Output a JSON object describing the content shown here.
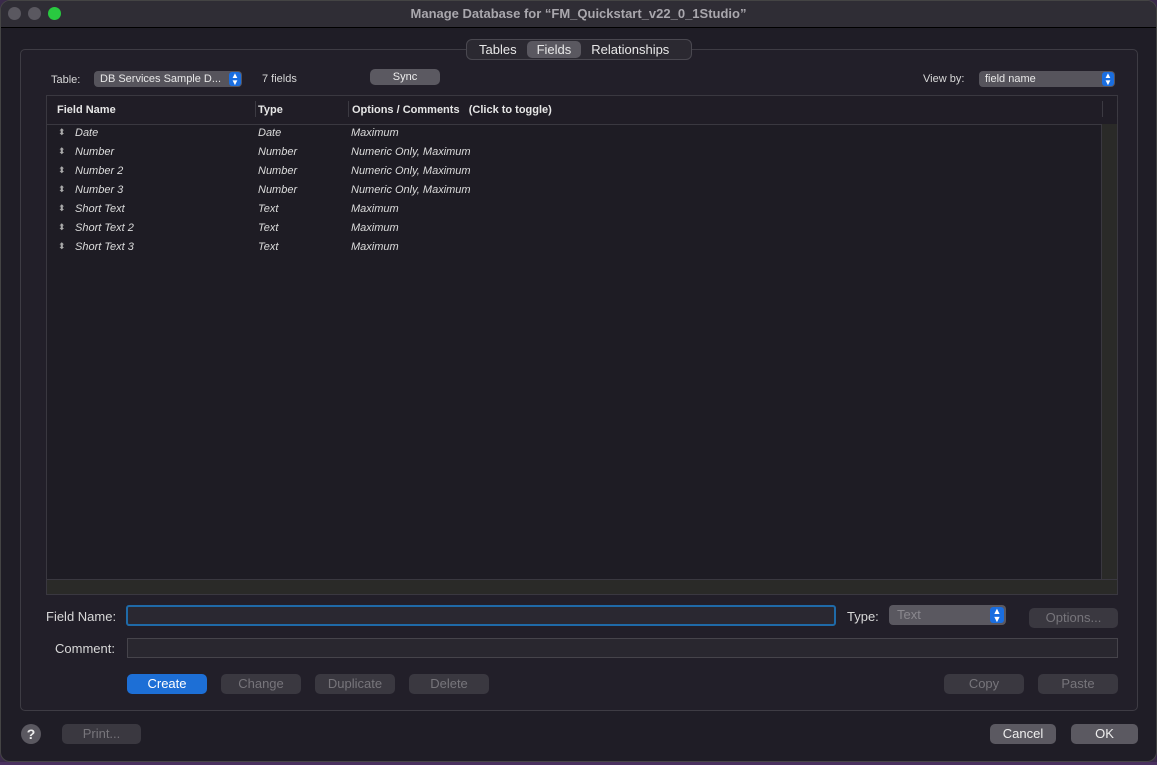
{
  "window": {
    "title": "Manage Database for “FM_Quickstart_v22_0_1Studio”"
  },
  "tabs": [
    {
      "label": "Tables",
      "active": false
    },
    {
      "label": "Fields",
      "active": true
    },
    {
      "label": "Relationships",
      "active": false
    }
  ],
  "toolbar": {
    "table_label": "Table:",
    "table_value": "DB Services Sample D...",
    "field_count": "7 fields",
    "sync_label": "Sync",
    "view_by_label": "View by:",
    "view_by_value": "field name"
  },
  "list": {
    "columns": [
      "Field Name",
      "Type",
      "Options / Comments   (Click to toggle)"
    ],
    "rows": [
      {
        "name": "Date",
        "type": "Date",
        "options": "Maximum"
      },
      {
        "name": "Number",
        "type": "Number",
        "options": "Numeric Only, Maximum"
      },
      {
        "name": "Number 2",
        "type": "Number",
        "options": "Numeric Only, Maximum"
      },
      {
        "name": "Number 3",
        "type": "Number",
        "options": "Numeric Only, Maximum"
      },
      {
        "name": "Short Text",
        "type": "Text",
        "options": "Maximum"
      },
      {
        "name": "Short Text 2",
        "type": "Text",
        "options": "Maximum"
      },
      {
        "name": "Short Text 3",
        "type": "Text",
        "options": "Maximum"
      }
    ]
  },
  "form": {
    "field_name_label": "Field Name:",
    "field_name_value": "",
    "type_label": "Type:",
    "type_value": "Text",
    "options_label": "Options...",
    "comment_label": "Comment:",
    "comment_value": ""
  },
  "actions": {
    "create": "Create",
    "change": "Change",
    "duplicate": "Duplicate",
    "delete": "Delete",
    "copy": "Copy",
    "paste": "Paste"
  },
  "footer": {
    "help": "?",
    "print": "Print...",
    "cancel": "Cancel",
    "ok": "OK"
  }
}
